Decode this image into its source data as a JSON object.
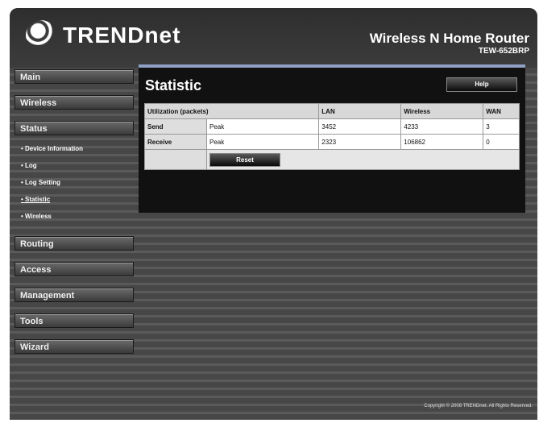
{
  "header": {
    "logo_text": "TRENDnet",
    "product_name": "Wireless N Home Router",
    "model": "TEW-652BRP"
  },
  "sidebar": {
    "main": "Main",
    "wireless": "Wireless",
    "status": "Status",
    "status_items": [
      "Device Information",
      "Log",
      "Log Setting",
      "Statistic",
      "Wireless"
    ],
    "routing": "Routing",
    "access": "Access",
    "management": "Management",
    "tools": "Tools",
    "wizard": "Wizard"
  },
  "content": {
    "title": "Statistic",
    "help_label": "Help",
    "table": {
      "headers": [
        "Utilization (packets)",
        "LAN",
        "Wireless",
        "WAN"
      ],
      "rows": [
        {
          "label": "Send",
          "peak": "Peak",
          "lan": "3452",
          "wireless": "4233",
          "wan": "3"
        },
        {
          "label": "Receive",
          "peak": "Peak",
          "lan": "2323",
          "wireless": "106862",
          "wan": "0"
        }
      ]
    },
    "reset_label": "Reset"
  },
  "footer": {
    "copyright": "Copyright © 2008 TRENDnet. All Rights Reserved."
  },
  "colors": {
    "accent_bar": "#8fa0c4",
    "background": "#4a4a4a"
  }
}
